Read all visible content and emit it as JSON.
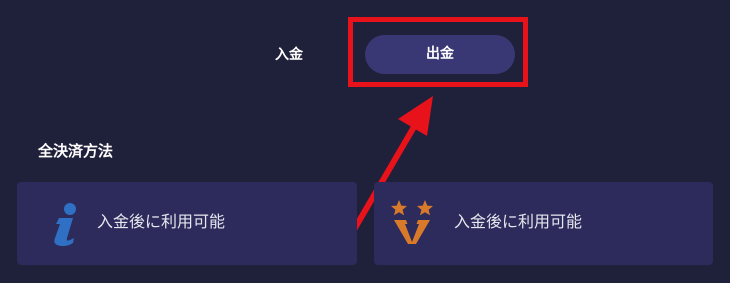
{
  "tabs": {
    "deposit_label": "入金",
    "withdraw_label": "出金"
  },
  "section": {
    "title": "全決済方法"
  },
  "payment_methods": [
    {
      "icon": "info-i-icon",
      "label": "入金後に利用可能"
    },
    {
      "icon": "vegawallet-stars-icon",
      "label": "入金後に利用可能"
    }
  ],
  "annotation": {
    "highlight_color": "#e8121b"
  },
  "colors": {
    "background": "#1f2039",
    "active_tab": "#3a3874",
    "card": "#2c2b5b",
    "icon_blue": "#2f6fc4",
    "icon_orange": "#d97a2b"
  }
}
